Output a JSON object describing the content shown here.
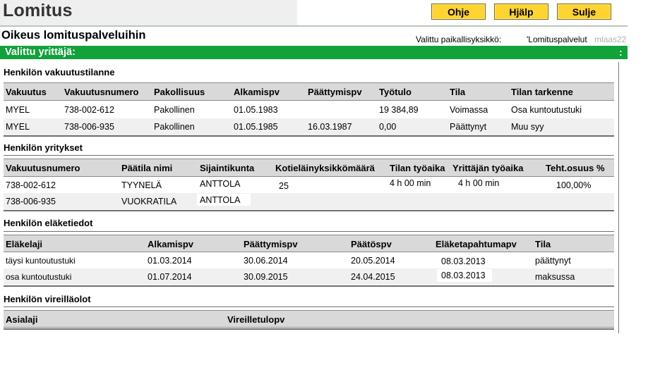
{
  "header": {
    "app_title": "Lomitus",
    "buttons": {
      "help_fi": "Ohje",
      "help_sv": "Hjälp",
      "close": "Sulje"
    },
    "subtitle": "Oikeus lomituspalveluihin",
    "unit_label": "Valittu paikallisyksikkö:",
    "unit_value": "'Lomituspalvelut",
    "user_id": "mlaas22"
  },
  "entrepreneur_bar": {
    "label": "Valittu yrittäjä:",
    "colon": ":"
  },
  "insurance": {
    "title": "Henkilön vakuutustilanne",
    "columns": [
      "Vakuutus",
      "Vakuutusnumero",
      "Pakollisuus",
      "Alkamispv",
      "Päättymispv",
      "Työtulo",
      "Tila",
      "Tilan tarkenne"
    ],
    "rows": [
      [
        "MYEL",
        "738-002-612",
        "Pakollinen",
        "01.05.1983",
        "",
        "19 384,89",
        "Voimassa",
        "Osa kuntoutustuki"
      ],
      [
        "MYEL",
        "738-006-935",
        "Pakollinen",
        "01.05.1985",
        "16.03.1987",
        "0,00",
        "Päättynyt",
        "Muu syy"
      ]
    ]
  },
  "companies": {
    "title": "Henkilön yritykset",
    "columns": [
      "Vakuutusnumero",
      "Päätila nimi",
      "Sijaintikunta",
      "Kotieläinyksikkömäärä",
      "Tilan työaika",
      "Yrittäjän työaika",
      "Teht.osuus %"
    ],
    "rows": [
      [
        "738-002-612",
        "TYYNELÄ",
        "ANTTOLA",
        "25",
        "4 h 00 min",
        "4 h 00 min",
        "100,00%"
      ],
      [
        "738-006-935",
        "VUOKRATILA",
        "ANTTOLA",
        "",
        "",
        "",
        ""
      ]
    ]
  },
  "pensions": {
    "title": "Henkilön eläketiedot",
    "columns": [
      "Eläkelaji",
      "Alkamispv",
      "Päättymispv",
      "Päätöspv",
      "Eläketapahtumapv",
      "Tila"
    ],
    "rows": [
      [
        "täysi kuntoutustuki",
        "01.03.2014",
        "30.06.2014",
        "20.05.2014",
        "08.03.2013",
        "päättynyt"
      ],
      [
        "osa kuntoutustuki",
        "01.07.2014",
        "30.09.2015",
        "24.04.2015",
        "08.03.2013",
        "maksussa"
      ]
    ]
  },
  "pending": {
    "title": "Henkilön vireilläolot",
    "columns": [
      "Asialaji",
      "Vireilletulopv"
    ]
  }
}
